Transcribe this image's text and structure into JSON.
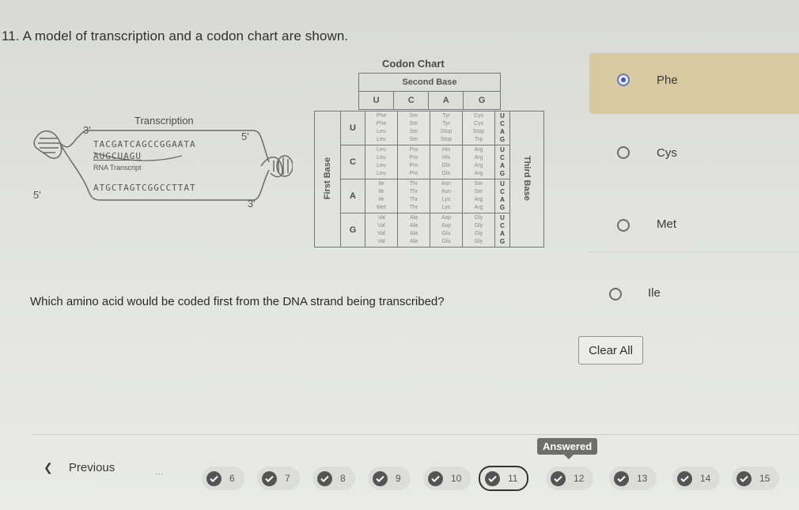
{
  "question": {
    "number": "11.",
    "stem": "A model of transcription and a codon chart are shown.",
    "prompt": "Which amino acid would be coded first from the DNA strand being transcribed?"
  },
  "transcription_diagram": {
    "title": "Transcription",
    "top_strand": "TACGATCAGCCGGAATA",
    "rna": "AUGCUAGU",
    "rna_label": "RNA Transcript",
    "bottom_strand": "ATGCTAGTCGGCCTTAT",
    "labels": {
      "top_left": "3'",
      "top_right": "5'",
      "bottom_left": "5'",
      "bottom_right": "3'"
    }
  },
  "codon_chart": {
    "title": "Codon Chart",
    "second_base_label": "Second Base",
    "first_base_label": "First Base",
    "third_base_label": "Third Base",
    "second_bases": [
      "U",
      "C",
      "A",
      "G"
    ],
    "rows": [
      {
        "first": "U",
        "cells": [
          [
            "Phe",
            "Phe",
            "Leu",
            "Leu"
          ],
          [
            "Ser",
            "Ser",
            "Ser",
            "Ser"
          ],
          [
            "Tyr",
            "Tyr",
            "Stop",
            "Stop"
          ],
          [
            "Cys",
            "Cys",
            "Stop",
            "Trp"
          ]
        ],
        "third": [
          "U",
          "C",
          "A",
          "G"
        ]
      },
      {
        "first": "C",
        "cells": [
          [
            "Leu",
            "Leu",
            "Leu",
            "Leu"
          ],
          [
            "Pro",
            "Pro",
            "Pro",
            "Pro"
          ],
          [
            "His",
            "His",
            "Gln",
            "Gln"
          ],
          [
            "Arg",
            "Arg",
            "Arg",
            "Arg"
          ]
        ],
        "third": [
          "U",
          "C",
          "A",
          "G"
        ]
      },
      {
        "first": "A",
        "cells": [
          [
            "Ile",
            "Ile",
            "Ile",
            "Met"
          ],
          [
            "Thr",
            "Thr",
            "Thr",
            "Thr"
          ],
          [
            "Asn",
            "Asn",
            "Lys",
            "Lys"
          ],
          [
            "Ser",
            "Ser",
            "Arg",
            "Arg"
          ]
        ],
        "third": [
          "U",
          "C",
          "A",
          "G"
        ]
      },
      {
        "first": "G",
        "cells": [
          [
            "Val",
            "Val",
            "Val",
            "Val"
          ],
          [
            "Ala",
            "Ala",
            "Ala",
            "Ala"
          ],
          [
            "Asp",
            "Asp",
            "Glu",
            "Glu"
          ],
          [
            "Gly",
            "Gly",
            "Gly",
            "Gly"
          ]
        ],
        "third": [
          "U",
          "C",
          "A",
          "G"
        ]
      }
    ]
  },
  "options": [
    {
      "label": "Phe",
      "selected": true
    },
    {
      "label": "Cys",
      "selected": false
    },
    {
      "label": "Met",
      "selected": false
    },
    {
      "label": "Ile",
      "selected": false
    }
  ],
  "clear_all_label": "Clear All",
  "nav": {
    "previous_label": "Previous",
    "ellipsis": "...",
    "tooltip": "Answered",
    "questions": [
      {
        "num": "6",
        "answered": true
      },
      {
        "num": "7",
        "answered": true
      },
      {
        "num": "8",
        "answered": true
      },
      {
        "num": "9",
        "answered": true
      },
      {
        "num": "10",
        "answered": true
      },
      {
        "num": "11",
        "answered": true,
        "current": true
      },
      {
        "num": "12",
        "answered": true
      },
      {
        "num": "13",
        "answered": true
      },
      {
        "num": "14",
        "answered": true
      },
      {
        "num": "15",
        "answered": true
      }
    ]
  },
  "colors": {
    "selected_option_bg": "#d9c9a0",
    "radio_selected": "#3f5bb5",
    "check_badge": "#545454"
  }
}
